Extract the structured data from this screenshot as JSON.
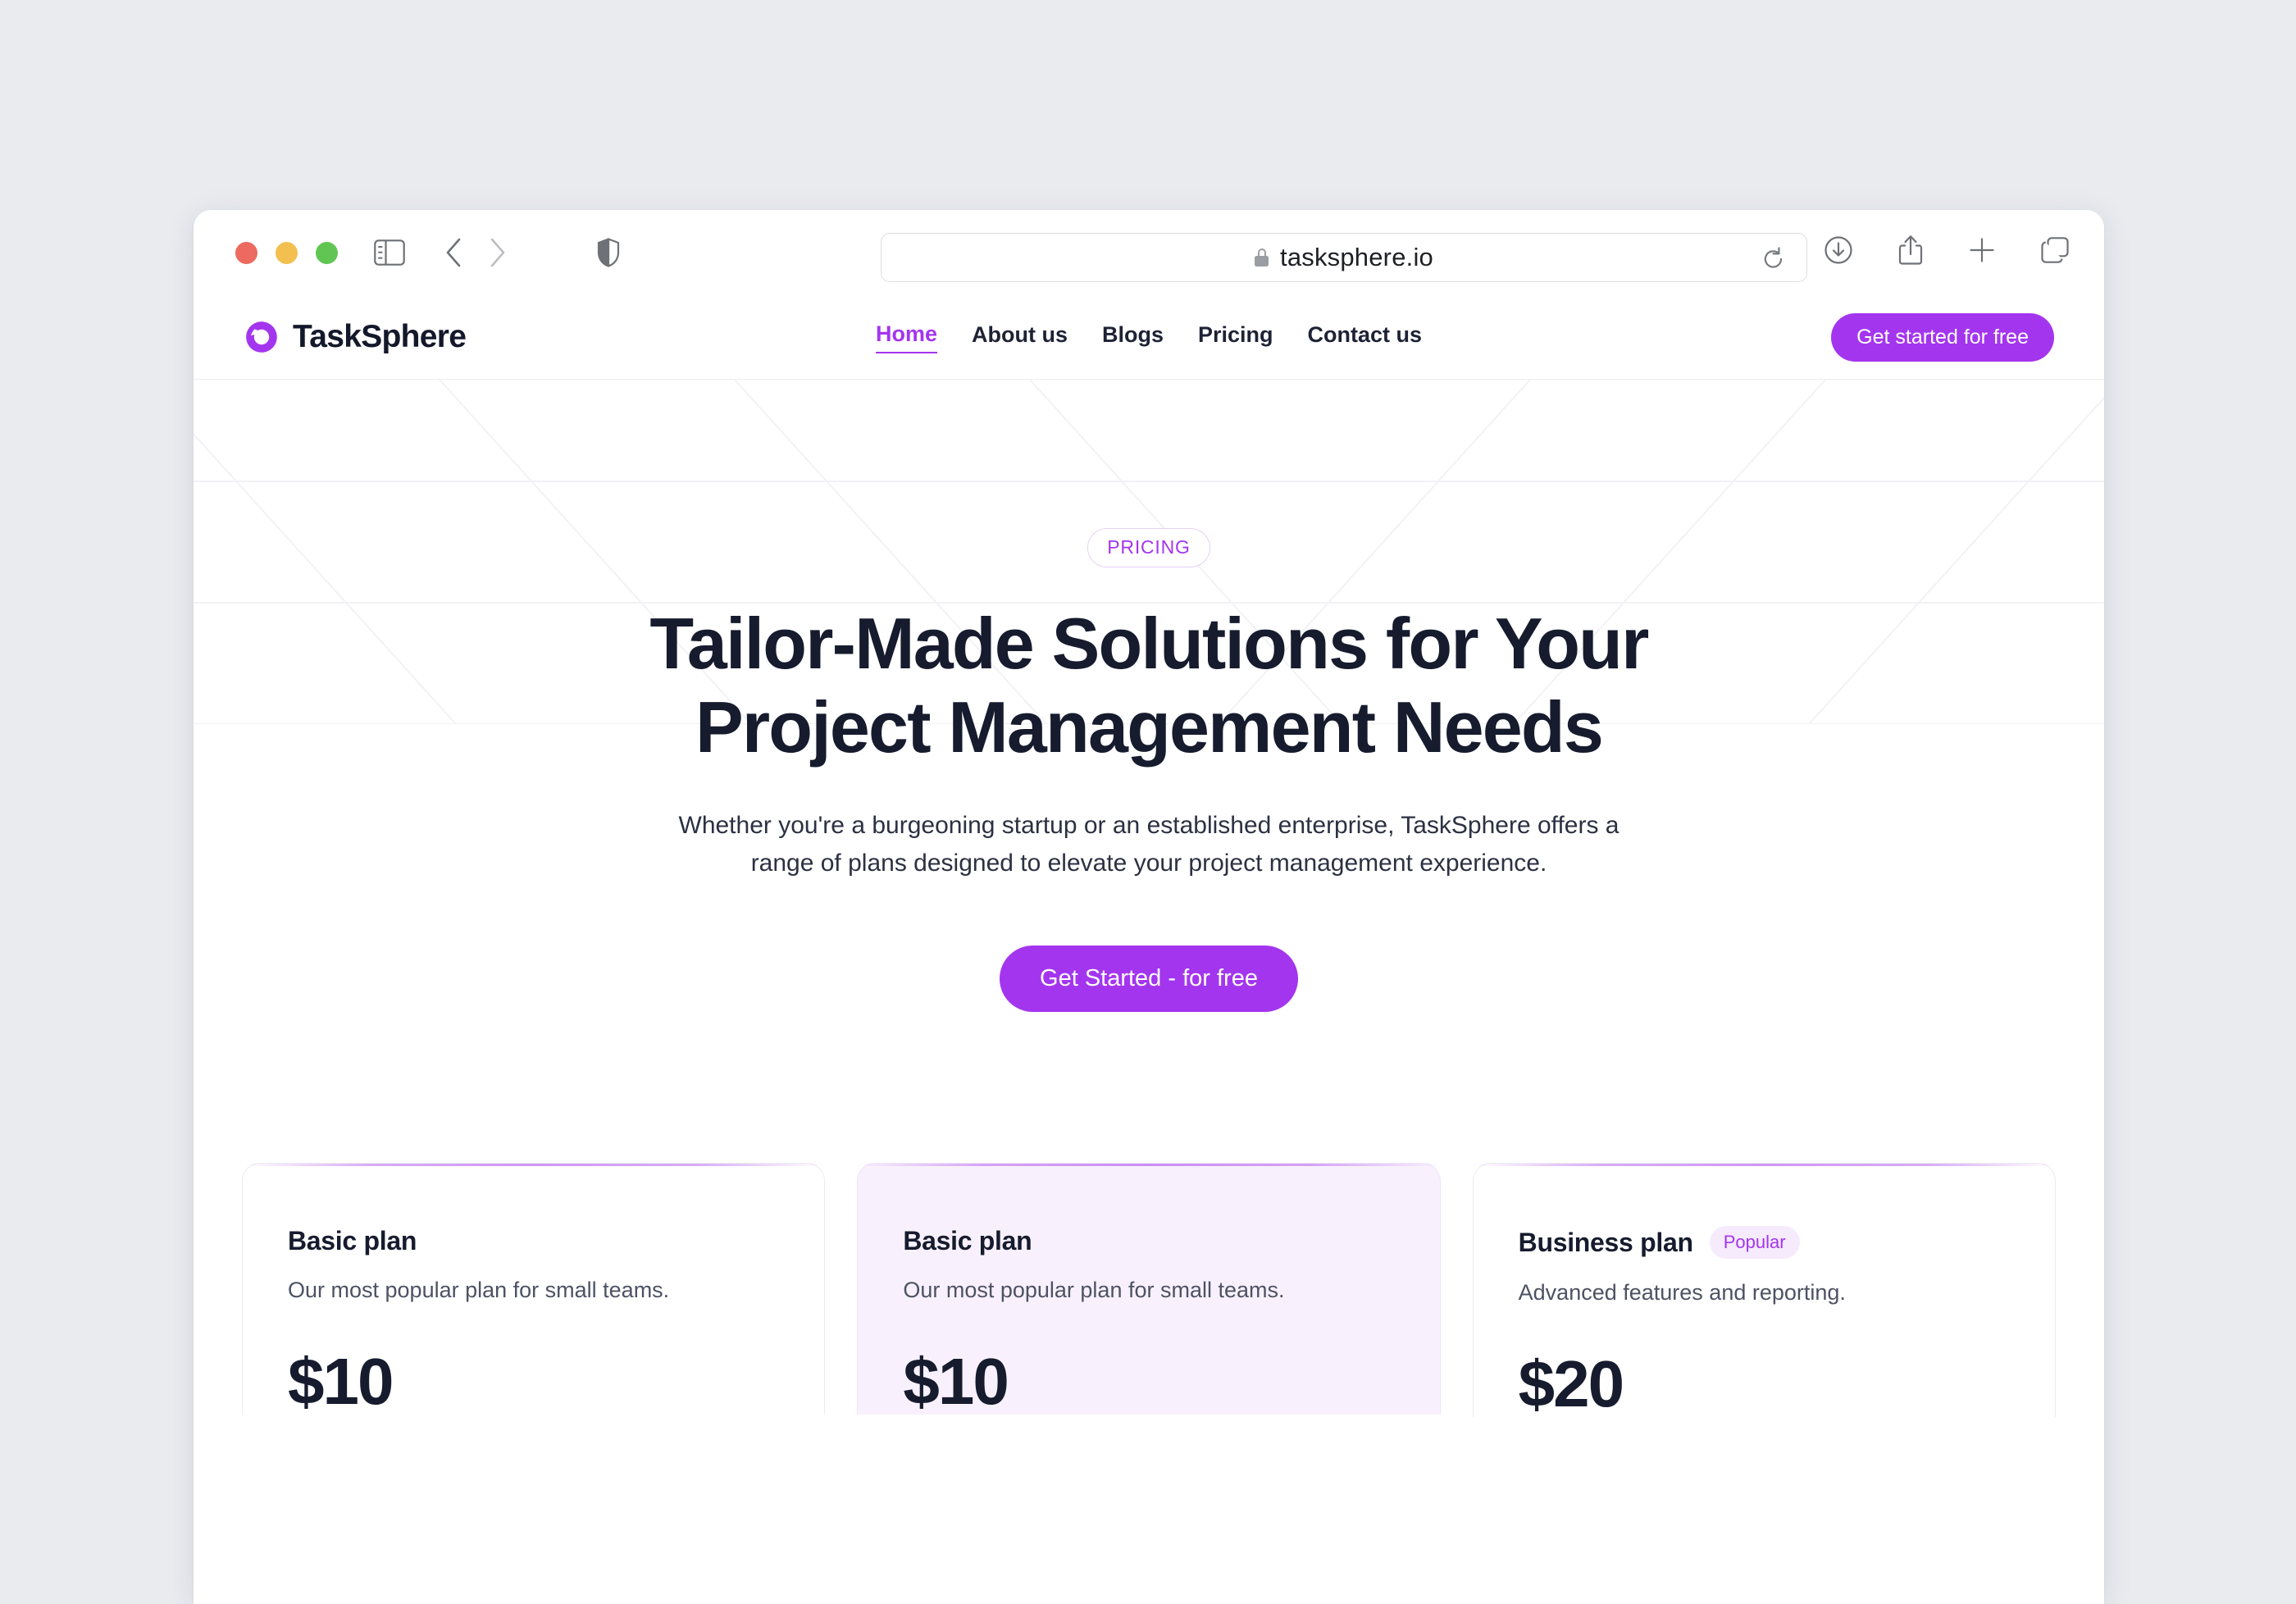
{
  "browser": {
    "traffic_lights": [
      "close",
      "minimize",
      "zoom"
    ],
    "sidebar_icon": "sidebar-toggle-icon",
    "back_icon": "chevron-left-icon",
    "forward_icon": "chevron-right-icon",
    "shield_icon": "privacy-shield-icon",
    "url": "tasksphere.io",
    "lock_icon": "lock-icon",
    "reload_icon": "reload-icon",
    "toolbar_right": [
      {
        "name": "downloads-icon"
      },
      {
        "name": "share-icon"
      },
      {
        "name": "new-tab-icon"
      },
      {
        "name": "tab-overview-icon"
      }
    ]
  },
  "site": {
    "brand": "TaskSphere",
    "logo_icon": "tasksphere-sphere-logo",
    "nav": [
      {
        "label": "Home",
        "active": true
      },
      {
        "label": "About us",
        "active": false
      },
      {
        "label": "Blogs",
        "active": false
      },
      {
        "label": "Pricing",
        "active": false
      },
      {
        "label": "Contact us",
        "active": false
      }
    ],
    "header_cta": "Get started for free"
  },
  "hero": {
    "eyebrow": "PRICING",
    "headline": "Tailor-Made Solutions for Your Project Management Needs",
    "subhead": "Whether you're a burgeoning startup or an established enterprise, TaskSphere offers a range of plans designed to elevate your project management experience.",
    "cta": "Get Started - for free"
  },
  "pricing_cards": [
    {
      "title": "Basic plan",
      "badge": "",
      "description": "Our most popular plan for small teams.",
      "price": "$10",
      "featured": false
    },
    {
      "title": "Basic plan",
      "badge": "",
      "description": "Our most popular plan for small teams.",
      "price": "$10",
      "featured": true
    },
    {
      "title": "Business plan",
      "badge": "Popular",
      "description": "Advanced features and reporting.",
      "price": "$20",
      "featured": false
    }
  ],
  "colors": {
    "accent": "#a435ef",
    "headline": "#161b2e",
    "page_bg": "#e9ebef",
    "featured_card_bg": "#f8f1fd",
    "badge_bg": "#f6ebfd"
  }
}
